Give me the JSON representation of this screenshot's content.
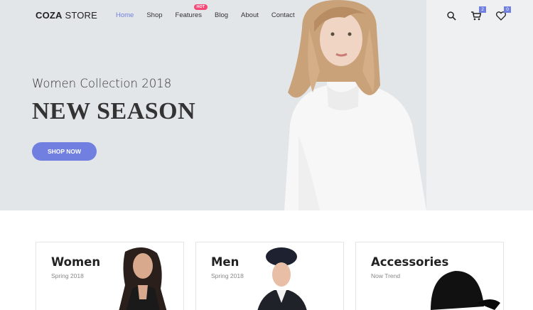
{
  "header": {
    "logo_bold": "COZA",
    "logo_rest": " STORE",
    "nav": [
      {
        "label": "Home",
        "active": true
      },
      {
        "label": "Shop"
      },
      {
        "label": "Features",
        "badge": "HOT"
      },
      {
        "label": "Blog"
      },
      {
        "label": "About"
      },
      {
        "label": "Contact"
      }
    ],
    "cart_count": "2",
    "wishlist_count": "0"
  },
  "hero": {
    "subtitle": "Women Collection 2018",
    "title": "NEW SEASON",
    "cta": "SHOP NOW"
  },
  "banners": [
    {
      "title": "Women",
      "subtitle": "Spring 2018"
    },
    {
      "title": "Men",
      "subtitle": "Spring 2018"
    },
    {
      "title": "Accessories",
      "subtitle": "Now Trend"
    }
  ],
  "colors": {
    "accent": "#717fe0",
    "hot": "#f74877",
    "hero_bg": "#e2e6e8"
  }
}
